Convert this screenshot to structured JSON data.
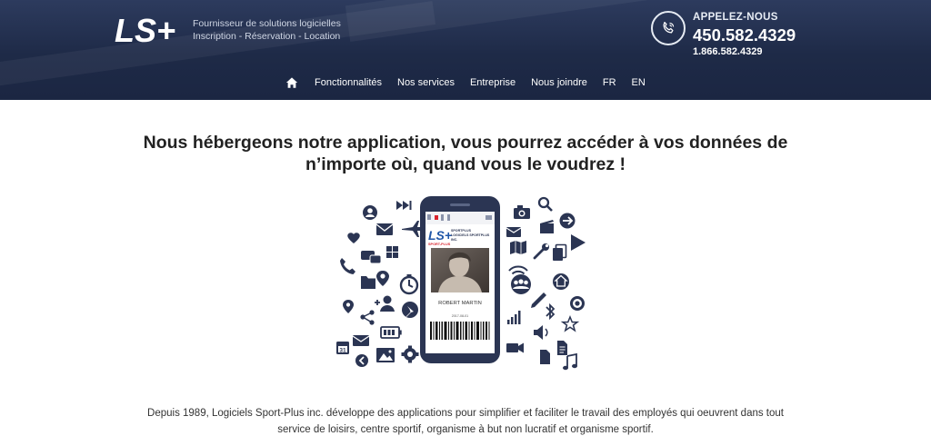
{
  "header": {
    "logo_text": "LS+",
    "tagline_line1": "Fournisseur de solutions logicielles",
    "tagline_line2": "Inscription - Réservation - Location",
    "call_label": "APPELEZ-NOUS",
    "phone_main": "450.582.4329",
    "phone_alt": "1.866.582.4329"
  },
  "nav": {
    "items": [
      "Fonctionnalités",
      "Nos services",
      "Entreprise",
      "Nous joindre",
      "FR",
      "EN"
    ]
  },
  "main": {
    "headline_line1": "Nous hébergeons notre application, vous pourrez accéder à vos données de",
    "headline_line2": "n’importe où, quand vous le voudrez !",
    "phone_card": {
      "logo_text": "LS+",
      "logo_sub": "SPORT-PLUS",
      "company_line1": "SPORTPLUS",
      "company_line2": "LOGICIELS SPORTPLUS",
      "company_line3": "INC.",
      "name": "ROBERT MARTIN",
      "date": "2017-08-01"
    },
    "intro_line1": "Depuis 1989, Logiciels Sport-Plus inc. développe des applications pour simplifier et faciliter le travail des employés qui oeuvrent dans tout",
    "intro_line2": "service de loisirs, centre sportif, organisme à but non lucratif et organisme sportif."
  },
  "colors": {
    "header_bg": "#1e2a47",
    "icon_navy": "#2b3553",
    "brand_red": "#d9232d",
    "brand_blue": "#1f56a8"
  }
}
